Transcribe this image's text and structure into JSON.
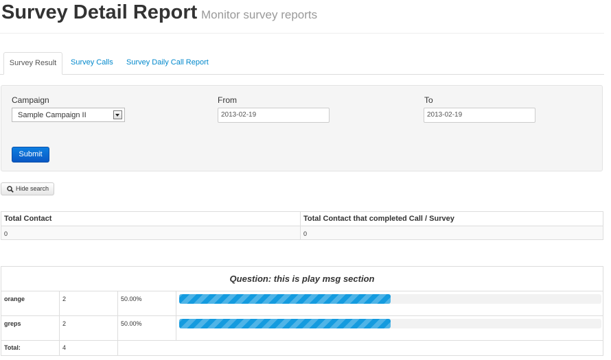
{
  "header": {
    "title": "Survey Detail Report",
    "subtitle": "Monitor survey reports"
  },
  "tabs": [
    {
      "label": "Survey Result",
      "active": true
    },
    {
      "label": "Survey Calls",
      "active": false
    },
    {
      "label": "Survey Daily Call Report",
      "active": false
    }
  ],
  "search": {
    "campaign_label": "Campaign",
    "campaign_value": "Sample Campaign II",
    "from_label": "From",
    "from_value": "2013-02-19",
    "to_label": "To",
    "to_value": "2013-02-19",
    "submit_label": "Submit"
  },
  "hide_search_label": "Hide search",
  "totals": {
    "headers": [
      "Total Contact",
      "Total Contact that completed Call / Survey"
    ],
    "values": [
      "0",
      "0"
    ]
  },
  "question": {
    "title": "Question: this is play msg section",
    "rows": [
      {
        "answer": "orange",
        "count": "2",
        "percent_label": "50.00%",
        "percent": 50
      },
      {
        "answer": "greps",
        "count": "2",
        "percent_label": "50.00%",
        "percent": 50
      }
    ],
    "total_label": "Total:",
    "total_value": "4"
  },
  "colors": {
    "link": "#0088cc",
    "primary_button": "#0a63cf",
    "progress": "#149bdf"
  }
}
